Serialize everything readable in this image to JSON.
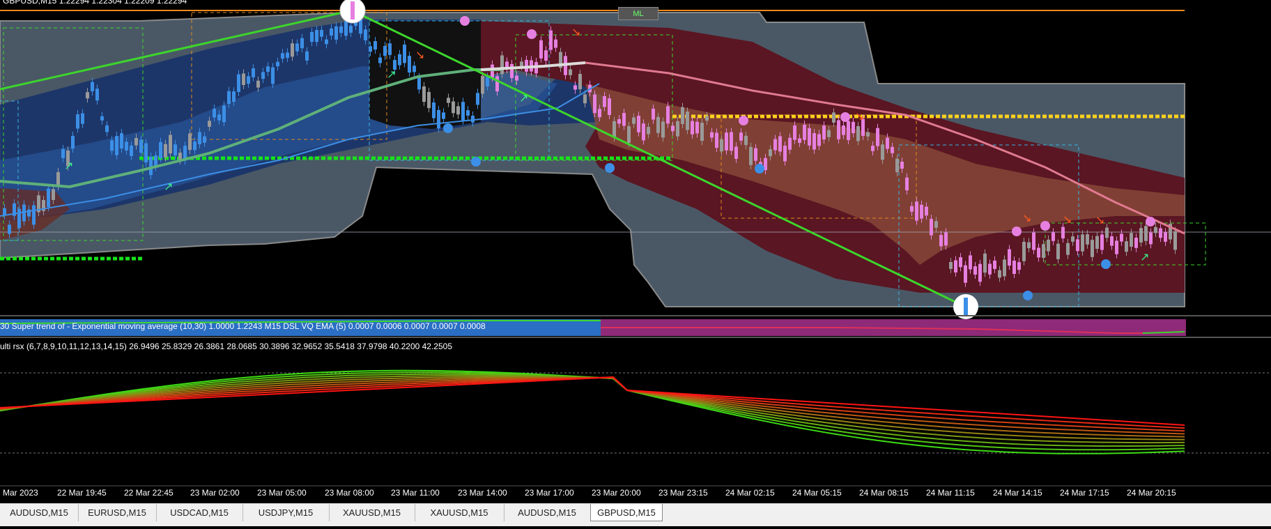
{
  "header": {
    "symbol_info": "GBPUSD,M15  1.22294 1.22304 1.22209 1.22294"
  },
  "ml_button": {
    "label": "ML"
  },
  "supertrend_label": "30  Super trend of - Exponential moving average (10,30)  1.0000 1.2243  M15 DSL  VQ  EMA (5)   0.0007 0.0006 0.0007 0.0007 0.0008",
  "rsx_label": "ulti rsx (6,7,8,9,10,11,12,13,14,15) 26.9496 25.8329 26.3861 28.0685 30.3896 32.9652 35.5418 37.9798 40.2200 42.2505",
  "time_axis": [
    "Mar 2023",
    "22 Mar 19:45",
    "22 Mar 22:45",
    "23 Mar 02:00",
    "23 Mar 05:00",
    "23 Mar 08:00",
    "23 Mar 11:00",
    "23 Mar 14:00",
    "23 Mar 17:00",
    "23 Mar 20:00",
    "23 Mar 23:15",
    "24 Mar 02:15",
    "24 Mar 05:15",
    "24 Mar 08:15",
    "24 Mar 11:15",
    "24 Mar 14:15",
    "24 Mar 17:15",
    "24 Mar 20:15"
  ],
  "tabs": [
    "AUDUSD,M15",
    "EURUSD,M15",
    "USDCAD,M15",
    "USDJPY,M15",
    "XAUUSD,M15",
    "XAUUSD,M15",
    "AUDUSD,M15",
    "GBPUSD,M15"
  ],
  "active_tab_index": 7,
  "colors": {
    "background": "#000000",
    "band_outer": "#4a5866",
    "bull_zone": "#1e3c6e",
    "bear_zone": "#5a1622",
    "bull_candle": "#3c8fe6",
    "bear_candle": "#e680e0",
    "neutral_candle": "#9a9a9a",
    "trendline": "#3cd62c",
    "level_yellow": "#ffd21e",
    "level_green": "#18e41a",
    "level_orange": "#f08a1e",
    "ma_white": "#dcdcdc",
    "ma_pink": "#e07a90"
  }
}
